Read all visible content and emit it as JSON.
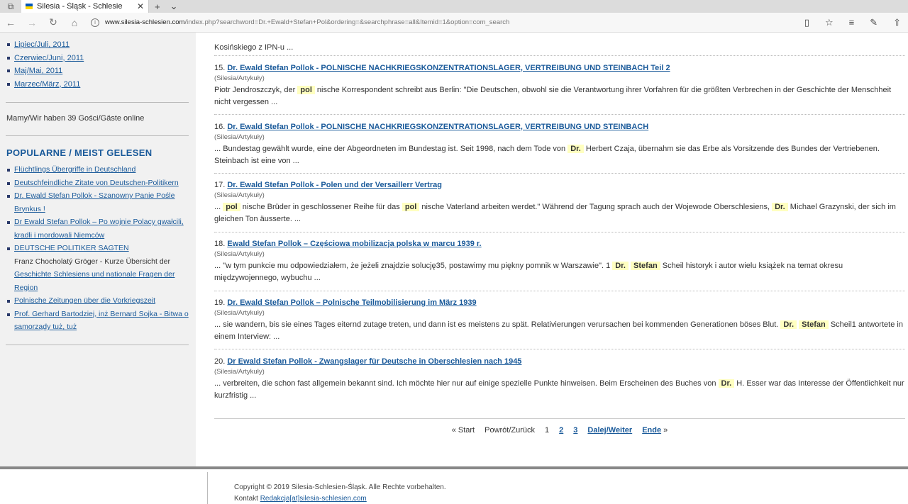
{
  "browser": {
    "tab_title": "Silesia - Śląsk - Schlesie",
    "url_domain": "www.silesia-schlesien.com",
    "url_path": "/index.php?searchword=Dr.+Ewald+Stefan+Pol&ordering=&searchphrase=all&Itemid=1&option=com_search",
    "colors": {
      "flag_top": "#0057b8",
      "flag_bottom": "#ffd700"
    }
  },
  "sidebar": {
    "archive": [
      "Lipiec/Juli, 2011",
      "Czerwiec/Juni, 2011",
      "Maj/Mai, 2011",
      "Marzec/März, 2011"
    ],
    "online": "Mamy/Wir haben 39 Gości/Gäste online",
    "popular_title": "POPULARNE / MEIST GELESEN",
    "popular": [
      "Flüchtlings Übergriffe in Deutschland",
      "Deutschfeindliche Zitate von Deutschen-Politikern",
      "Dr. Ewald Stefan Pollok - Szanowny Panie Pośle Brynkus !",
      "Dr Ewald Stefan Pollok – Po wojnie Polacy gwałcili, kradli i mordowali Niemców",
      "DEUTSCHE POLITIKER SAGTEN",
      "Franz Chocholatý Gröger - Kurze Übersicht der",
      "Geschichte Schlesiens und nationale Fragen der Region",
      "Polnische Zeitungen über die Vorkriegszeit",
      "Prof. Gerhard Bartodziej, inż Bernard Sojka - Bitwa o samorządy tuż, tuż"
    ]
  },
  "results": {
    "prev_tail": "Kosińskiego z IPN-u ...",
    "items": [
      {
        "num": "15.",
        "title": "Dr. Ewald Stefan Pollok - POLNISCHE NACHKRIEGSKONZENTRATIONSLAGER, VERTREIBUNG UND STEINBACH Teil 2",
        "category": "(Silesia/Artykuły)",
        "t1": "Piotr Jendroszczyk, der ",
        "h1": "pol",
        "t2": " nische Korrespondent schreibt aus Berlin: \"Die Deutschen, obwohl sie die Verantwortung ihrer Vorfahren für die größten Verbrechen in der Geschichte der Menschheit nicht vergessen ..."
      },
      {
        "num": "16.",
        "title": "Dr. Ewald Stefan Pollok - POLNISCHE NACHKRIEGSKONZENTRATIONSLAGER, VERTREIBUNG UND STEINBACH",
        "category": "(Silesia/Artykuły)",
        "t1": "... Bundestag gewählt wurde, eine der Abgeordneten im Bundestag ist. Seit 1998, nach dem Tode von ",
        "h1": "Dr.",
        "t2": " Herbert Czaja, übernahm sie das Erbe als Vorsitzende des Bundes der Vertriebenen. Steinbach ist eine von ..."
      },
      {
        "num": "17.",
        "title": "Dr. Ewald Stefan Pollok - Polen und der Versaillerr Vertrag",
        "category": "(Silesia/Artykuły)",
        "t1": "... ",
        "h1": "pol",
        "t2": " nische Brüder in geschlossener Reihe für das ",
        "h2": "pol",
        "t3": " nische Vaterland arbeiten werdet.\" Während der Tagung sprach auch der Wojewode Oberschlesiens, ",
        "h3": "Dr.",
        "t4": " Michael Grazynski, der sich im gleichen Ton äusserte. ..."
      },
      {
        "num": "18.",
        "title": "Ewald Stefan Pollok – Częściowa mobilizacja polska w marcu 1939 r.",
        "category": "(Silesia/Artykuły)",
        "t1": "... \"w tym punkcie mu odpowiedziałem, że jeżeli znajdzie solucję35, postawimy mu piękny pomnik w Warszawie\". 1 ",
        "h1": "Dr.",
        "h2": "Stefan",
        "t2": " Scheil historyk i autor wielu książek na temat okresu międzywojennego, wybuchu ..."
      },
      {
        "num": "19.",
        "title": "Dr. Ewald Stefan Pollok – Polnische Teilmobilisierung im März 1939",
        "category": "(Silesia/Artykuły)",
        "t1": "... sie wandern, bis sie eines Tages eiternd zutage treten, und dann ist es meistens zu spät. Relativierungen verursachen bei kommenden Generationen böses Blut. ",
        "h1": "Dr.",
        "h2": "Stefan",
        "t2": " Scheil1 antwortete in einem Interview: ..."
      },
      {
        "num": "20.",
        "title": "Dr Ewald Stefan Pollok - Zwangslager für Deutsche in Oberschlesien nach 1945",
        "category": "(Silesia/Artykuły)",
        "t1": "... verbreiten, die schon fast allgemein bekannt sind. Ich möchte hier nur auf einige spezielle Punkte hinweisen. Beim Erscheinen des Buches von ",
        "h1": "Dr.",
        "t2": " H. Esser war das Interesse der Öffentlichkeit nur kurzfristig ..."
      }
    ]
  },
  "pager": {
    "start": "« Start",
    "prev": "Powrót/Zurück",
    "p1": "1",
    "p2": "2",
    "p3": "3",
    "next": "Dalej/Weiter",
    "end": "Ende",
    "end_mark": "»"
  },
  "footer": {
    "copyright": "Copyright © 2019 Silesia-Schlesien-Śląsk. Alle Rechte vorbehalten.",
    "contact_label": "Kontakt ",
    "contact_link": "Redakcja[at]silesia-schlesien.com"
  }
}
